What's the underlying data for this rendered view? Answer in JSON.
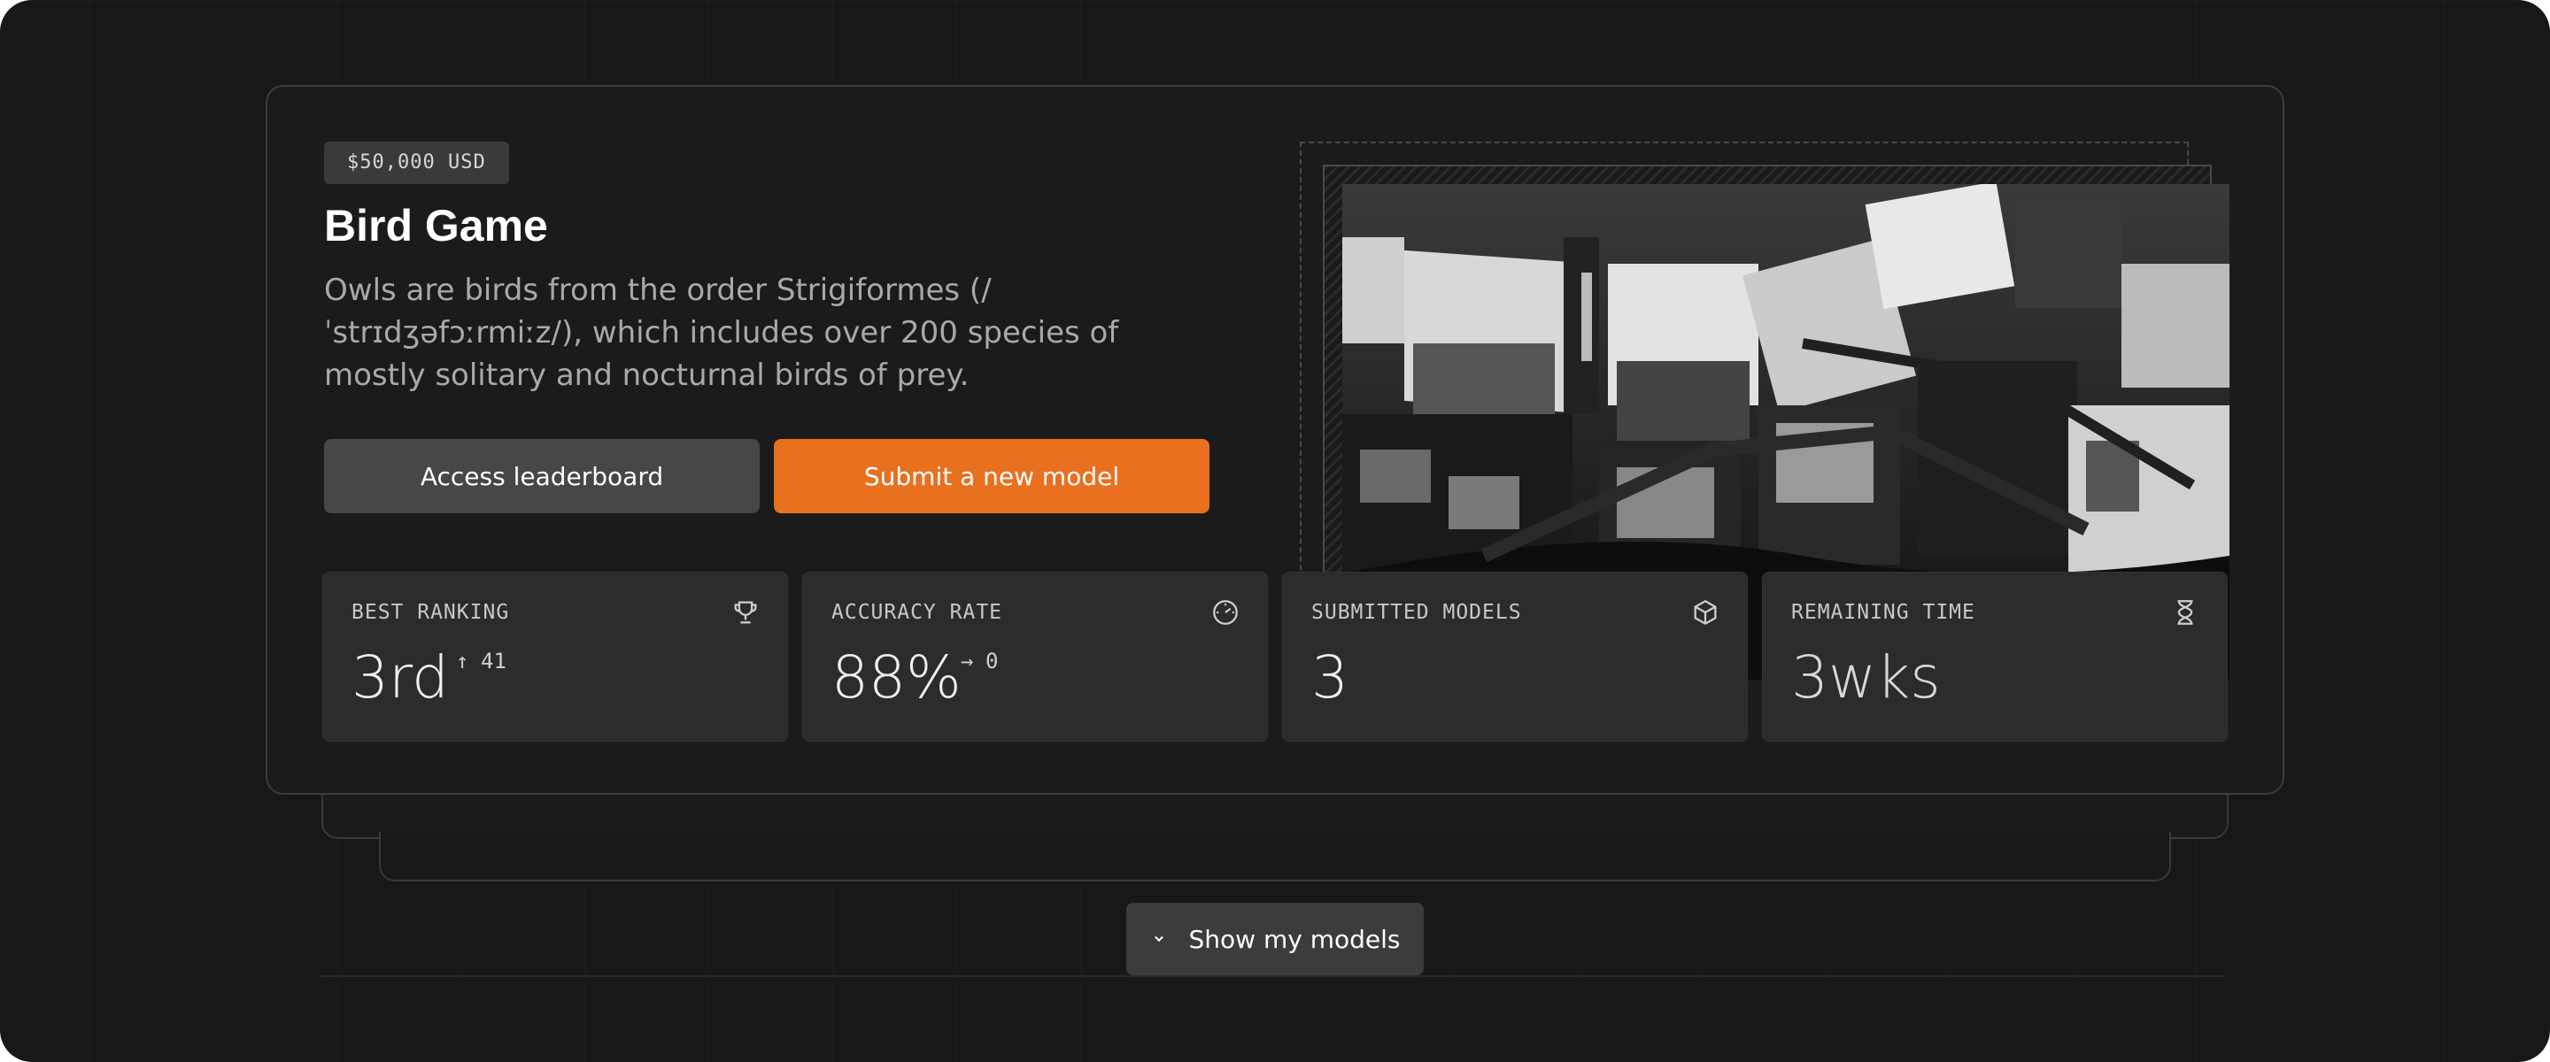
{
  "competition": {
    "prize": "$50,000 USD",
    "title": "Bird Game",
    "description": "Owls are birds from the order Strigiformes (/ ˈstrɪdʒəfɔːrmiːz/), which includes over 200 species of mostly solitary and nocturnal birds of prey.",
    "buttons": {
      "leaderboard": "Access leaderboard",
      "submit": "Submit a new model"
    }
  },
  "stats": [
    {
      "label": "BEST RANKING",
      "value": "3rd",
      "sub_arrow": "↑",
      "sub_value": "41",
      "icon": "trophy-icon"
    },
    {
      "label": "ACCURACY RATE",
      "value": "88%",
      "sub_arrow": "→",
      "sub_value": "0",
      "icon": "gauge-icon"
    },
    {
      "label": "SUBMITTED MODELS",
      "value": "3",
      "icon": "cube-icon"
    },
    {
      "label": "REMAINING TIME",
      "value": "3wks",
      "icon": "hourglass-icon"
    }
  ],
  "footer": {
    "show_models": "Show my models"
  },
  "colors": {
    "background": "#181818",
    "card": "#1b1b1b",
    "accent": "#e8701f",
    "stat_card": "#2c2c2c"
  }
}
